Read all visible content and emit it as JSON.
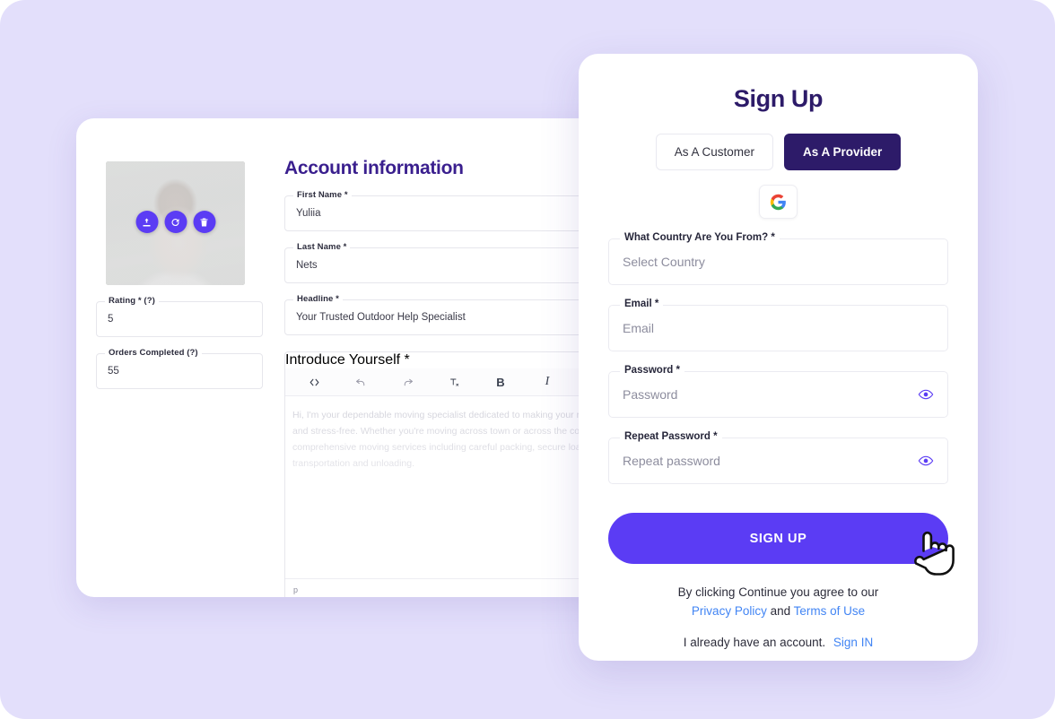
{
  "theme": {
    "page_background": "#e3dffb",
    "accent_purple": "#5b3cf4",
    "deep_indigo": "#2d1b69",
    "heading_purple": "#3a1f8e",
    "link_blue": "#4285f4"
  },
  "profile_card": {
    "title": "Account information",
    "avatar": {
      "name": "profile-photo",
      "actions": [
        {
          "name": "upload-icon",
          "label": "Upload"
        },
        {
          "name": "rotate-icon",
          "label": "Rotate"
        },
        {
          "name": "delete-icon",
          "label": "Delete"
        }
      ]
    },
    "left_fields": [
      {
        "label": "Rating * (?)",
        "value": "5"
      },
      {
        "label": "Orders Completed (?)",
        "value": "55"
      }
    ],
    "right_fields": [
      {
        "label": "First Name *",
        "value": "Yuliia"
      },
      {
        "label": "Last Name *",
        "value": "Nets"
      },
      {
        "label": "Headline *",
        "value": "Your Trusted Outdoor Help Specialist"
      }
    ],
    "editor": {
      "label": "Introduce Yourself *",
      "toolbar": [
        {
          "name": "code-icon",
          "label": "<>"
        },
        {
          "name": "undo-icon",
          "label": "Undo"
        },
        {
          "name": "redo-icon",
          "label": "Redo"
        },
        {
          "name": "clear-format-icon",
          "label": "Tx"
        },
        {
          "name": "bold-icon",
          "label": "B"
        },
        {
          "name": "italic-icon",
          "label": "I"
        }
      ],
      "placeholder": "Hi, I'm your dependable moving specialist dedicated to making your relocation smooth and stress-free. Whether you're moving across town or across the country, I offer comprehensive moving services including careful packing, secure loading, safe transportation and unloading.",
      "status": "p"
    }
  },
  "signup_card": {
    "title": "Sign Up",
    "tabs": [
      {
        "label": "As A Customer",
        "active": false
      },
      {
        "label": "As A Provider",
        "active": true
      }
    ],
    "social": {
      "google_label": "G"
    },
    "fields": [
      {
        "label": "What Country Are You From? *",
        "value": "Select Country",
        "is_placeholder": true,
        "has_eye": false
      },
      {
        "label": "Email *",
        "value": "Email",
        "is_placeholder": true,
        "has_eye": false
      },
      {
        "label": "Password *",
        "value": "Password",
        "is_placeholder": true,
        "has_eye": true
      },
      {
        "label": "Repeat Password *",
        "value": "Repeat password",
        "is_placeholder": true,
        "has_eye": true
      }
    ],
    "submit_label": "SIGN UP",
    "legal": {
      "line1": "By clicking Continue you agree to our",
      "privacy_policy": "Privacy Policy",
      "and": "and",
      "terms_of_use": "Terms of Use"
    },
    "account_prompt": {
      "text": "I already have an account.",
      "sign_in": "Sign IN"
    }
  }
}
